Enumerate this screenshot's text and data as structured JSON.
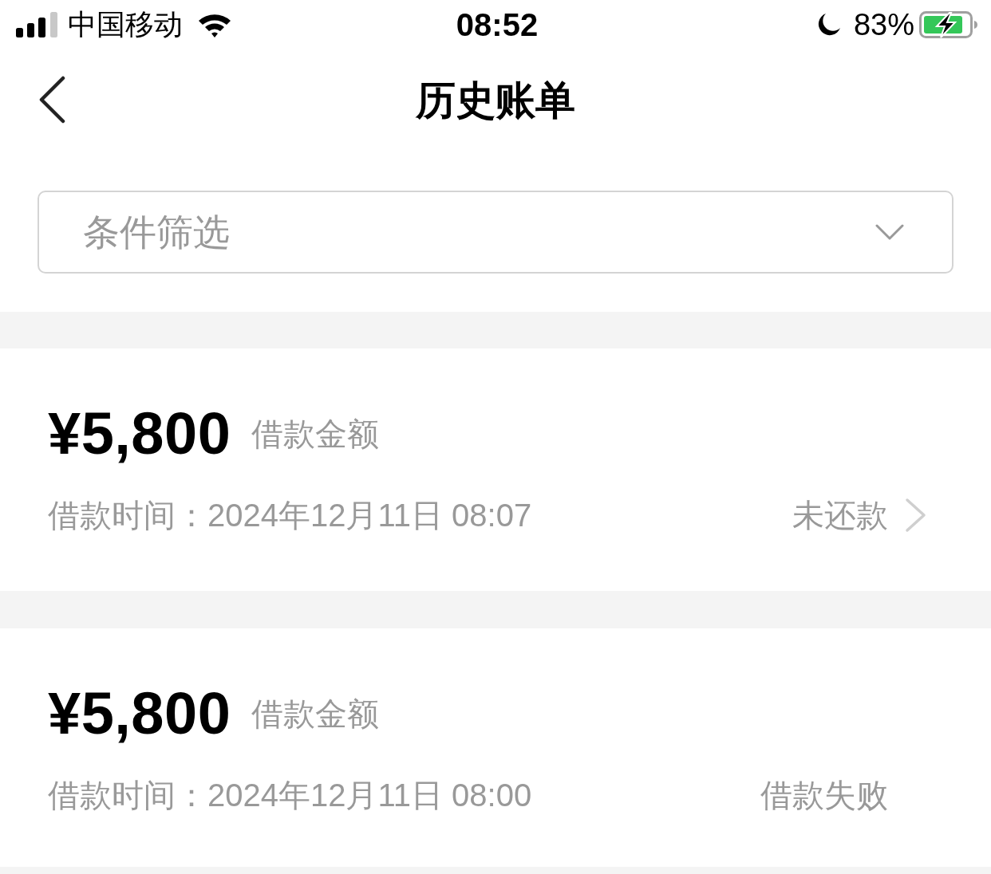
{
  "status_bar": {
    "carrier": "中国移动",
    "time": "08:52",
    "battery": "83%"
  },
  "nav": {
    "title": "历史账单"
  },
  "filter": {
    "placeholder": "条件筛选"
  },
  "bills": [
    {
      "amount": "¥5,800",
      "amount_label": "借款金额",
      "time": "借款时间：2024年12月11日 08:07",
      "status": "未还款",
      "chevron": true
    },
    {
      "amount": "¥5,800",
      "amount_label": "借款金额",
      "time": "借款时间：2024年12月11日 08:00",
      "status": "借款失败",
      "chevron": false
    }
  ]
}
